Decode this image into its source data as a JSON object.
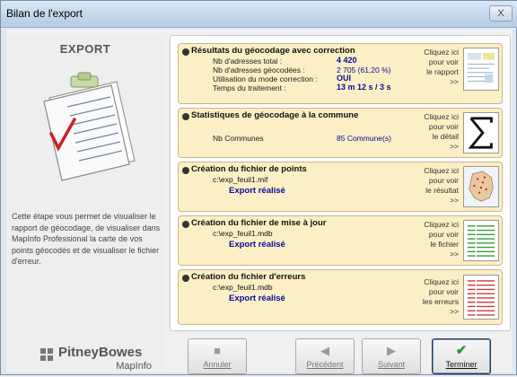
{
  "window": {
    "title": "Bilan de l'export",
    "close_glyph": "X"
  },
  "left": {
    "heading": "EXPORT",
    "description": "Cette étape vous permet de visualiser le rapport de géocodage, de visualiser dans MapInfo Professional la carte de vos points géocodés et de visualiser le fichier d'erreur.",
    "brand_name": "PitneyBowes",
    "brand_sub": "MapInfo",
    "illustration_icon": "clipboard-checklist-icon"
  },
  "cards": [
    {
      "title": "Résultats du géocodage avec correction",
      "rows": [
        {
          "label": "Nb d'adresses total :",
          "value": "4 420"
        },
        {
          "label": "Nb d'adresses géocodées :",
          "value": "2 705 (61,20 %)"
        },
        {
          "label": "Utilisation du mode correction :",
          "value": "OUI"
        },
        {
          "label": "Temps du traitement :",
          "value": "13 m 12 s /  3 s"
        }
      ],
      "link_lines": [
        "Cliquez ici",
        "pour voir",
        "le rapport",
        ">>"
      ],
      "thumb_icon": "report-thumbnail-icon"
    },
    {
      "title": "Statistiques de géocodage à la commune",
      "rows": [
        {
          "label": "Nb Communes",
          "value": "85 Commune(s)"
        }
      ],
      "link_lines": [
        "Cliquez ici",
        "pour voir",
        "le détail",
        ">>"
      ],
      "thumb_icon": "sigma-icon"
    },
    {
      "title": "Création du fichier de points",
      "path": "c:\\exp_feuil1.mif",
      "status": "Export réalisé",
      "link_lines": [
        "Cliquez ici",
        "pour voir",
        "le résultat",
        ">>"
      ],
      "thumb_icon": "france-map-icon"
    },
    {
      "title": "Création du fichier de mise à jour",
      "path": "c:\\exp_feuil1.mdb",
      "status": "Export réalisé",
      "link_lines": [
        "Cliquez ici",
        "pour voir",
        "le fichier",
        ">>"
      ],
      "thumb_icon": "spreadsheet-green-icon"
    },
    {
      "title": "Création du fichier d'erreurs",
      "path": "c:\\exp_feuil1.mdb",
      "status": "Export réalisé",
      "link_lines": [
        "Cliquez ici",
        "pour voir",
        "les erreurs",
        ">>"
      ],
      "thumb_icon": "spreadsheet-red-icon"
    }
  ],
  "buttons": {
    "cancel": {
      "label": "Annuler",
      "icon": "stop-square-icon",
      "glyph": "■"
    },
    "previous": {
      "label": "Précédent",
      "icon": "arrow-left-icon",
      "glyph": "◀"
    },
    "next": {
      "label": "Suivant",
      "icon": "arrow-right-icon",
      "glyph": "▶"
    },
    "finish": {
      "label": "Terminer",
      "icon": "checkmark-icon",
      "glyph": "✔"
    }
  }
}
